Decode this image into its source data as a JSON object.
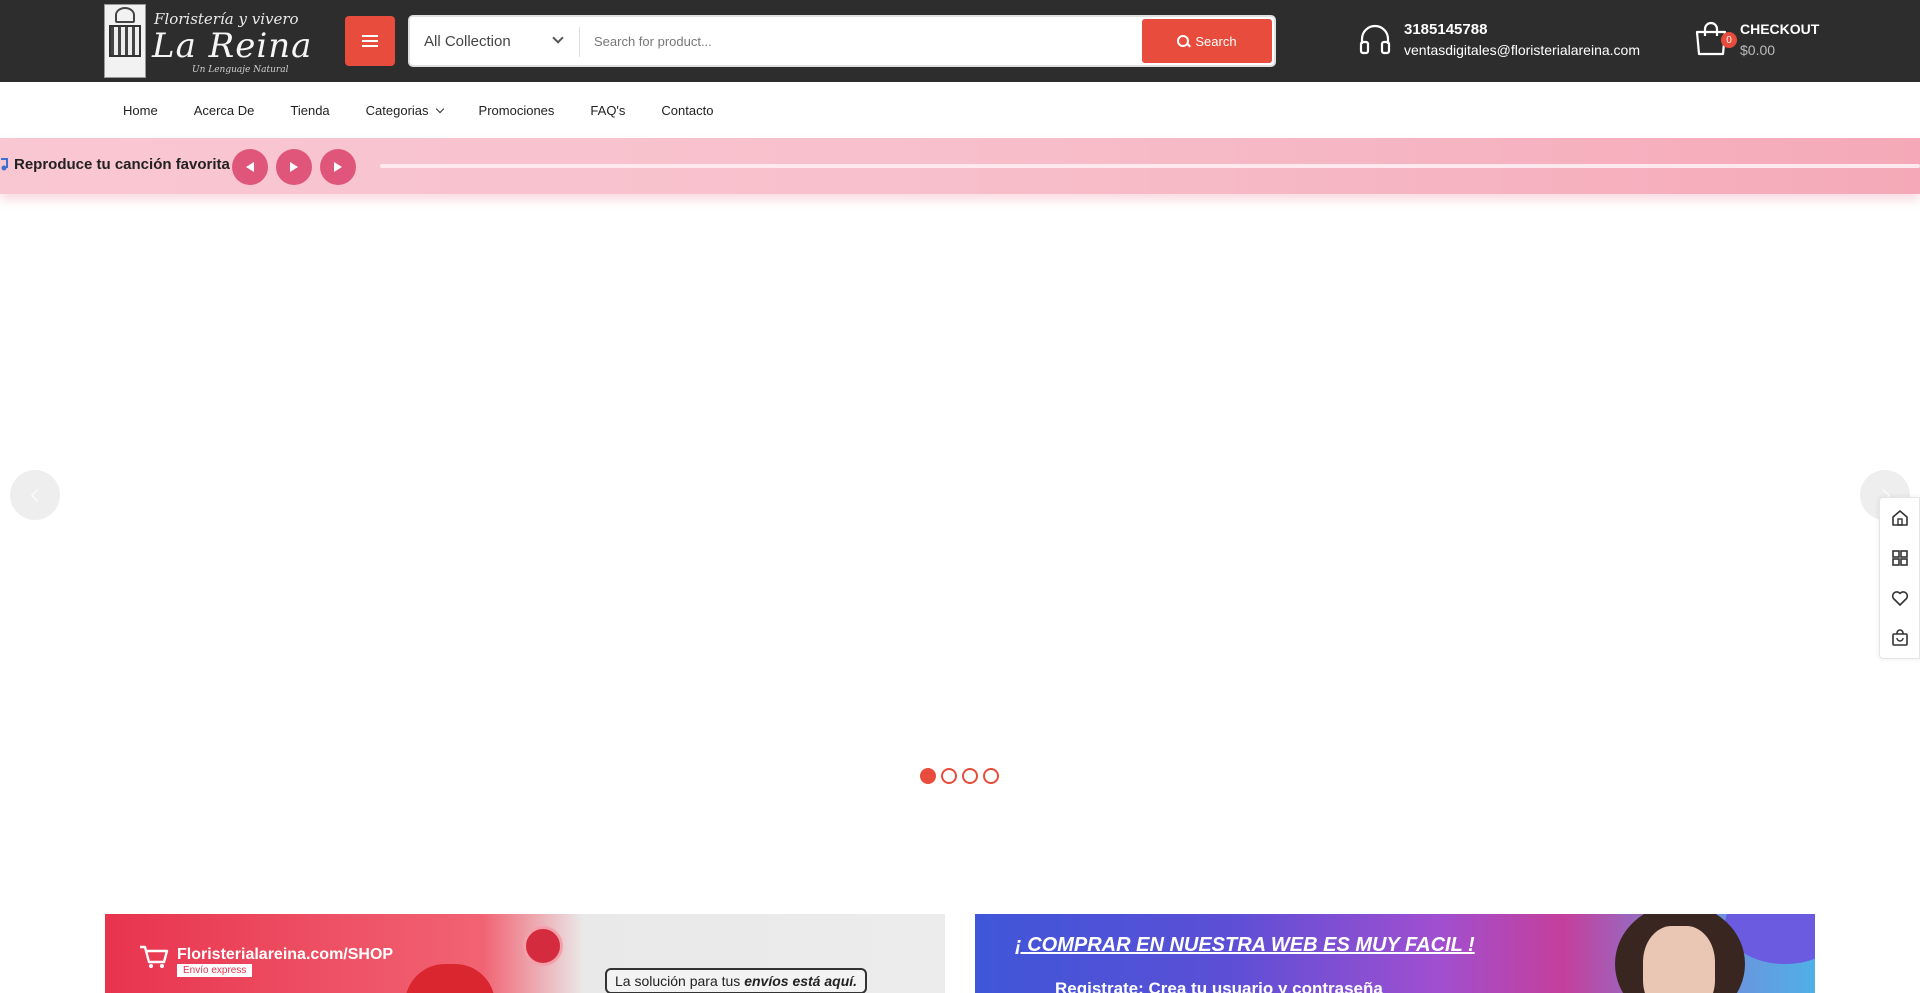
{
  "header": {
    "logo": {
      "line1": "Floristería y vivero",
      "line2": "La Reina",
      "line3": "Un Lenguaje Natural"
    },
    "search": {
      "collection_selected": "All Collection",
      "placeholder": "Search for product...",
      "button_label": "Search"
    },
    "contact": {
      "phone": "3185145788",
      "email": "ventasdigitales@floristerialareina.com"
    },
    "cart": {
      "count": "0",
      "label": "CHECKOUT",
      "total": "$0.00"
    }
  },
  "nav": {
    "items": [
      {
        "label": "Home"
      },
      {
        "label": "Acerca De"
      },
      {
        "label": "Tienda"
      },
      {
        "label": "Categorias",
        "has_dropdown": true
      },
      {
        "label": "Promociones"
      },
      {
        "label": "FAQ's"
      },
      {
        "label": "Contacto"
      }
    ]
  },
  "music_bar": {
    "title": "Reproduce tu canción favorita"
  },
  "slider": {
    "dots_count": 4,
    "active_dot": 1
  },
  "side_tools": [
    "home-icon",
    "grid-icon",
    "heart-icon",
    "bag-icon"
  ],
  "banners": {
    "left": {
      "shop_text": "Floristerialareina.com/SHOP",
      "express_text": "Envío express",
      "tagline_prefix": "La solución para tus ",
      "tagline_bold": "envíos está aquí."
    },
    "right": {
      "headline": "¡ COMPRAR EN NUESTRA WEB ES MUY FACIL !",
      "subline": "Registrate: Crea tu usuario y contraseña"
    }
  },
  "colors": {
    "header_bg": "#2d2d2d",
    "accent": "#e74c3c",
    "music_bar_pink": "#f7bfcb",
    "music_button": "#e0557a"
  }
}
